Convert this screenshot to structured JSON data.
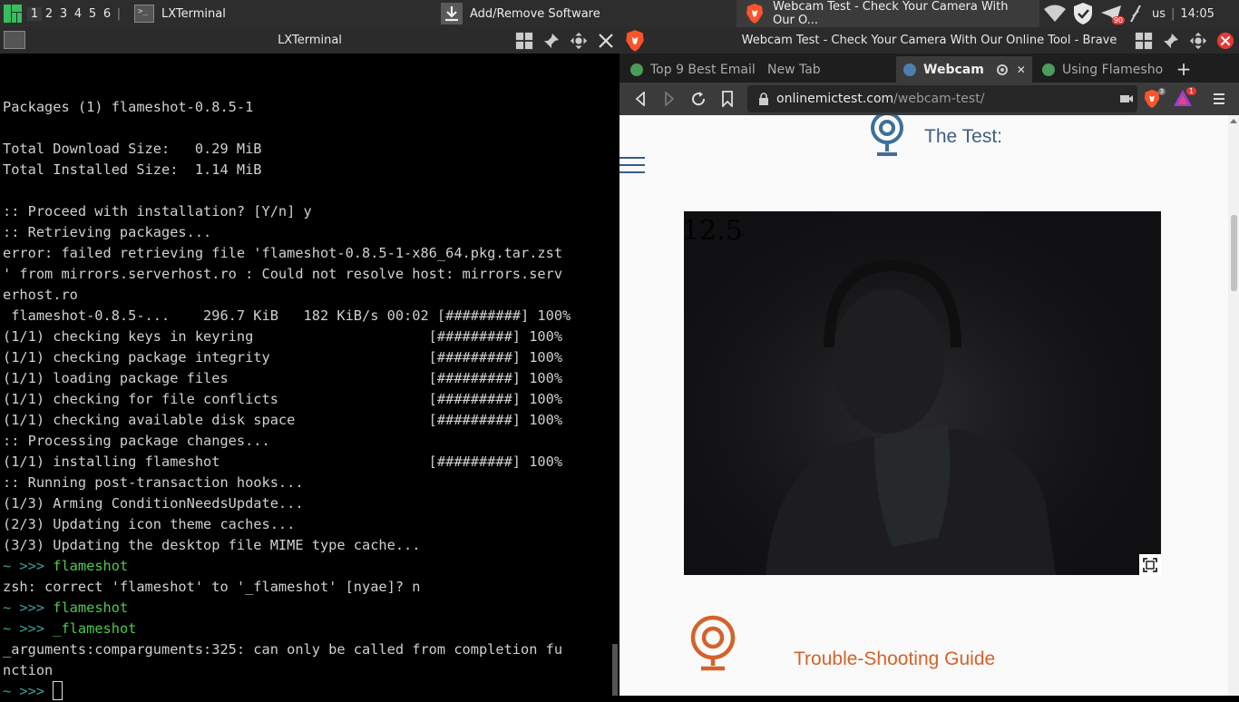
{
  "panel": {
    "workspaces": [
      "1",
      "2",
      "3",
      "4",
      "5",
      "6"
    ],
    "workspace_separator": "|",
    "tasks": [
      {
        "label": "LXTerminal"
      },
      {
        "label": "Add/Remove Software"
      },
      {
        "label": "Webcam Test - Check Your Camera With Our O..."
      }
    ],
    "keyboard_layout": "us",
    "clock": "14:05",
    "clock_separator": "|",
    "tray_badge": "90"
  },
  "terminal": {
    "title": "LXTerminal",
    "lines": [
      {
        "type": "text",
        "text": ""
      },
      {
        "type": "text",
        "text": "Packages (1) flameshot-0.8.5-1"
      },
      {
        "type": "text",
        "text": ""
      },
      {
        "type": "text",
        "text": "Total Download Size:   0.29 MiB"
      },
      {
        "type": "text",
        "text": "Total Installed Size:  1.14 MiB"
      },
      {
        "type": "text",
        "text": ""
      },
      {
        "type": "text",
        "text": ":: Proceed with installation? [Y/n] y"
      },
      {
        "type": "text",
        "text": ":: Retrieving packages..."
      },
      {
        "type": "text",
        "text": "error: failed retrieving file 'flameshot-0.8.5-1-x86_64.pkg.tar.zst"
      },
      {
        "type": "text",
        "text": "' from mirrors.serverhost.ro : Could not resolve host: mirrors.serv"
      },
      {
        "type": "text",
        "text": "erhost.ro"
      },
      {
        "type": "text",
        "text": " flameshot-0.8.5-...    296.7 KiB   182 KiB/s 00:02 [#########] 100%"
      },
      {
        "type": "text",
        "text": "(1/1) checking keys in keyring                     [#########] 100%"
      },
      {
        "type": "text",
        "text": "(1/1) checking package integrity                   [#########] 100%"
      },
      {
        "type": "text",
        "text": "(1/1) loading package files                        [#########] 100%"
      },
      {
        "type": "text",
        "text": "(1/1) checking for file conflicts                  [#########] 100%"
      },
      {
        "type": "text",
        "text": "(1/1) checking available disk space                [#########] 100%"
      },
      {
        "type": "text",
        "text": ":: Processing package changes..."
      },
      {
        "type": "text",
        "text": "(1/1) installing flameshot                         [#########] 100%"
      },
      {
        "type": "text",
        "text": ":: Running post-transaction hooks..."
      },
      {
        "type": "text",
        "text": "(1/3) Arming ConditionNeedsUpdate..."
      },
      {
        "type": "text",
        "text": "(2/3) Updating icon theme caches..."
      },
      {
        "type": "text",
        "text": "(3/3) Updating the desktop file MIME type cache..."
      },
      {
        "type": "prompt",
        "prompt": "~ >>> ",
        "cmd": "flameshot"
      },
      {
        "type": "text",
        "text": "zsh: correct 'flameshot' to '_flameshot' [nyae]? n"
      },
      {
        "type": "prompt",
        "prompt": "~ >>> ",
        "cmd": "flameshot"
      },
      {
        "type": "prompt",
        "prompt": "~ >>> ",
        "cmd": "_flameshot"
      },
      {
        "type": "text",
        "text": "_arguments:comparguments:325: can only be called from completion fu"
      },
      {
        "type": "text",
        "text": "nction"
      },
      {
        "type": "cursor",
        "prompt": "~ >>> ",
        "cmd": ""
      }
    ]
  },
  "browser": {
    "title": "Webcam Test - Check Your Camera With Our Online Tool - Brave",
    "tabs": [
      {
        "label": "Top 9 Best Email",
        "active": false,
        "fav_color": "#4a9c5a"
      },
      {
        "label": "New Tab",
        "active": false,
        "fav_color": ""
      },
      {
        "label": "Webcam",
        "active": true,
        "fav_color": "#4d7fae"
      },
      {
        "label": "Using Flamesho",
        "active": false,
        "fav_color": "#4a9c5a"
      }
    ],
    "new_tab_symbol": "+",
    "close_tab_symbol": "✕",
    "url_host": "onlinemictest.com",
    "url_path": "/webcam-test/",
    "shield_count": "3",
    "rewards_count": "1",
    "page": {
      "test_heading": "The Test:",
      "fps_overlay": "12.5",
      "trouble_heading": "Trouble-Shooting Guide",
      "heading_color": "#3d5f7f",
      "accent_color": "#d4622a"
    }
  }
}
